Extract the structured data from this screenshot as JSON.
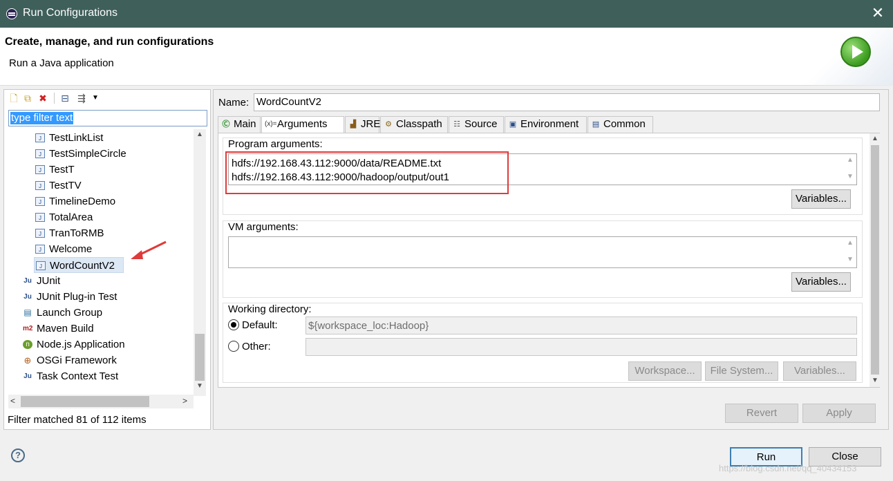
{
  "window": {
    "title": "Run Configurations",
    "close_glyph": "✕",
    "logo_icon": "eclipse-icon"
  },
  "header": {
    "title": "Create, manage, and run configurations",
    "subtitle": "Run a Java application",
    "icon": "run-icon"
  },
  "left": {
    "toolbar": [
      "new-config-icon",
      "duplicate-icon",
      "delete-icon",
      "collapse-all-icon",
      "filter-icon"
    ],
    "filter_text": "type filter text",
    "tree": [
      {
        "label": "TestLinkList",
        "icon": "java-file-icon",
        "level": 2
      },
      {
        "label": "TestSimpleCircle",
        "icon": "java-file-icon",
        "level": 2
      },
      {
        "label": "TestT",
        "icon": "java-file-icon",
        "level": 2
      },
      {
        "label": "TestTV",
        "icon": "java-file-icon",
        "level": 2
      },
      {
        "label": "TimelineDemo",
        "icon": "java-file-icon",
        "level": 2
      },
      {
        "label": "TotalArea",
        "icon": "java-file-icon",
        "level": 2
      },
      {
        "label": "TranToRMB",
        "icon": "java-file-icon",
        "level": 2
      },
      {
        "label": "Welcome",
        "icon": "java-file-icon",
        "level": 2
      },
      {
        "label": "WordCountV2",
        "icon": "java-file-icon",
        "level": 2,
        "selected": true
      },
      {
        "label": "JUnit",
        "icon": "junit-icon",
        "level": 1
      },
      {
        "label": "JUnit Plug-in Test",
        "icon": "junit-plugin-icon",
        "level": 1
      },
      {
        "label": "Launch Group",
        "icon": "launch-group-icon",
        "level": 1
      },
      {
        "label": "Maven Build",
        "icon": "maven-icon",
        "level": 1
      },
      {
        "label": "Node.js Application",
        "icon": "nodejs-icon",
        "level": 1
      },
      {
        "label": "OSGi Framework",
        "icon": "osgi-icon",
        "level": 1
      },
      {
        "label": "Task Context Test",
        "icon": "task-context-icon",
        "level": 1
      }
    ],
    "status": "Filter matched 81 of 112 items"
  },
  "right": {
    "name_label": "Name:",
    "name_value": "WordCountV2",
    "tabs": [
      {
        "label": "Main",
        "icon": "main-tab-icon"
      },
      {
        "label": "Arguments",
        "icon": "arguments-tab-icon",
        "active": true
      },
      {
        "label": "JRE",
        "icon": "jre-tab-icon"
      },
      {
        "label": "Classpath",
        "icon": "classpath-tab-icon"
      },
      {
        "label": "Source",
        "icon": "source-tab-icon"
      },
      {
        "label": "Environment",
        "icon": "environment-tab-icon"
      },
      {
        "label": "Common",
        "icon": "common-tab-icon"
      }
    ],
    "program_args": {
      "label": "Program arguments:",
      "line1": "hdfs://192.168.43.112:9000/data/README.txt",
      "line2": "hdfs://192.168.43.112:9000/hadoop/output/out1",
      "variables": "Variables..."
    },
    "vm_args": {
      "label": "VM arguments:",
      "value": "",
      "variables": "Variables..."
    },
    "working_dir": {
      "label": "Working directory:",
      "default_label": "Default:",
      "default_value": "${workspace_loc:Hadoop}",
      "default_checked": true,
      "other_label": "Other:",
      "other_value": "",
      "workspace_btn": "Workspace...",
      "filesystem_btn": "File System...",
      "variables_btn": "Variables..."
    },
    "revert": "Revert",
    "apply": "Apply"
  },
  "footer": {
    "run": "Run",
    "close": "Close",
    "watermark": "https://blog.csdn.net/qq_40434153"
  },
  "colors": {
    "titlebar": "#3f5f5a",
    "highlight": "#e03a3a",
    "selection": "#3399ff"
  }
}
